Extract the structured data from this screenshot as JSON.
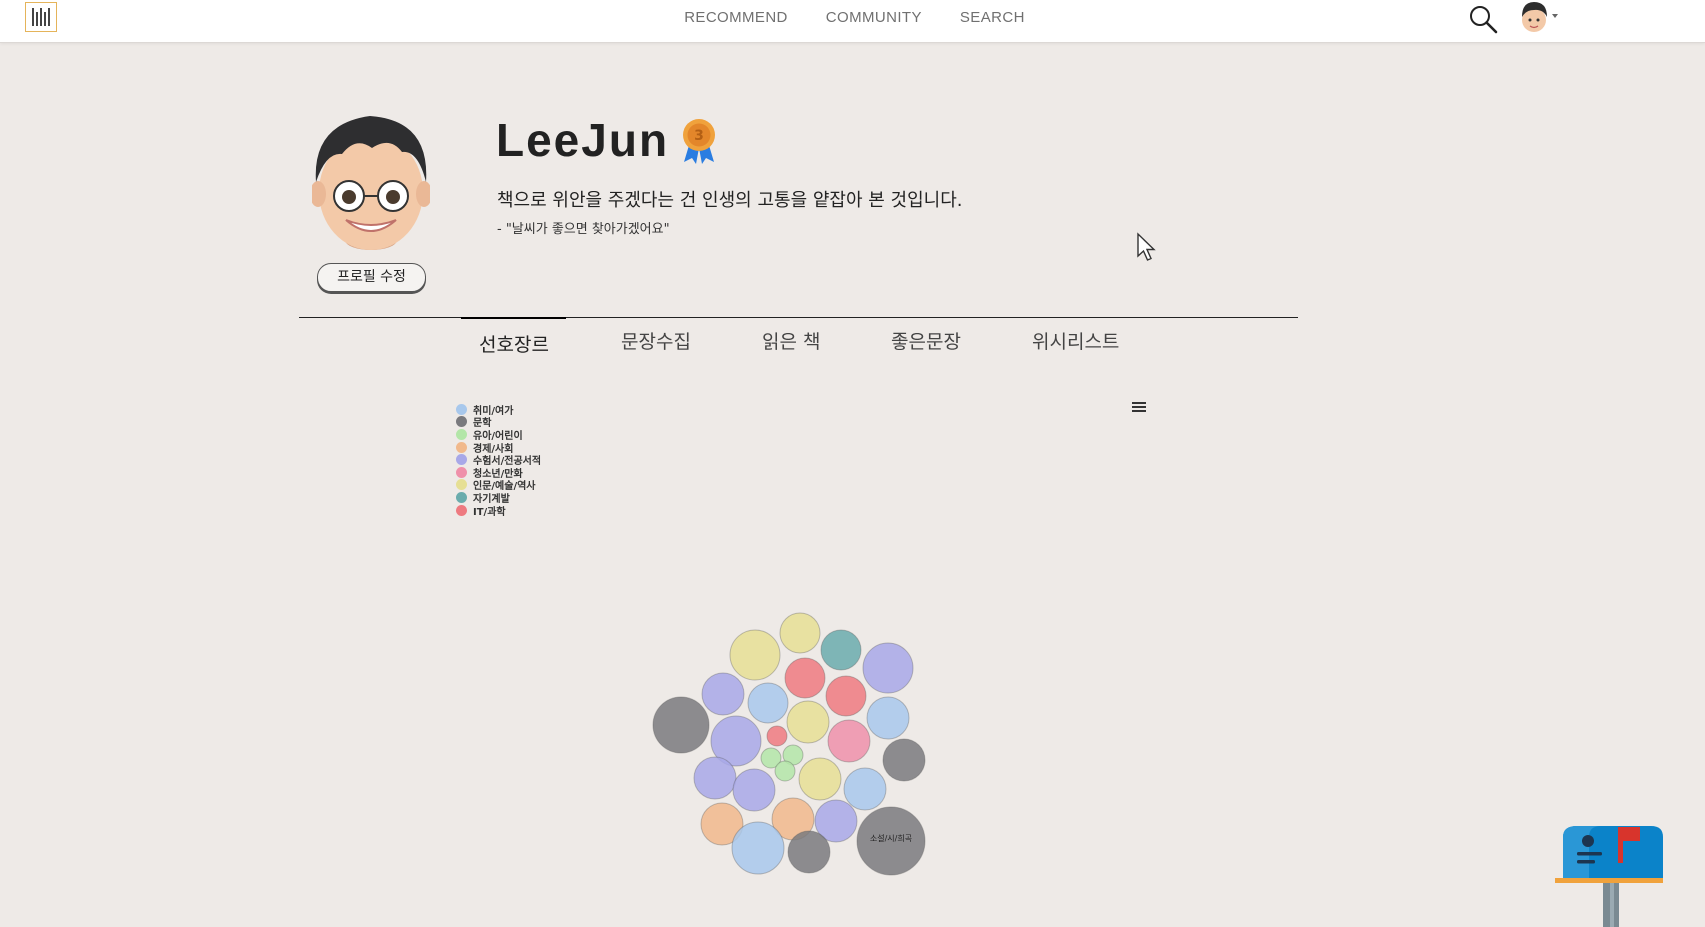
{
  "nav": {
    "items": [
      "RECOMMEND",
      "COMMUNITY",
      "SEARCH"
    ]
  },
  "profile": {
    "username": "LeeJun",
    "medal_rank": "3",
    "quote": "책으로 위안을 주겠다는 건 인생의 고통을 얕잡아 본 것입니다.",
    "quote_sub": "- \"날씨가 좋으면 찾아가겠어요\"",
    "edit_label": "프로필 수정",
    "badges": [
      "yarn-badge-icon",
      "globe-chart-badge-icon",
      "book-badge-icon",
      "science-badge-icon",
      "newspaper-badge-icon",
      "castle-badge-icon",
      "growth-badge-icon"
    ]
  },
  "tabs": [
    {
      "label": "선호장르",
      "active": true
    },
    {
      "label": "문장수집",
      "active": false
    },
    {
      "label": "읽은 책",
      "active": false
    },
    {
      "label": "좋은문장",
      "active": false
    },
    {
      "label": "위시리스트",
      "active": false
    }
  ],
  "chart_data": {
    "type": "packed-bubble",
    "legend": [
      {
        "name": "취미/여가",
        "color": "#a8c8ec"
      },
      {
        "name": "문학",
        "color": "#7a7a7e"
      },
      {
        "name": "유아/어린이",
        "color": "#b3e6a8"
      },
      {
        "name": "경제/사회",
        "color": "#f1b98c"
      },
      {
        "name": "수험서/전공서적",
        "color": "#a8a8e8"
      },
      {
        "name": "청소년/만화",
        "color": "#ef90aa"
      },
      {
        "name": "인문/예술/역사",
        "color": "#e6df94"
      },
      {
        "name": "자기계발",
        "color": "#6aacad"
      },
      {
        "name": "IT/과학",
        "color": "#ee7a80"
      }
    ],
    "bubble_label": "소설/시/희곡",
    "legend_position": "top-left"
  }
}
